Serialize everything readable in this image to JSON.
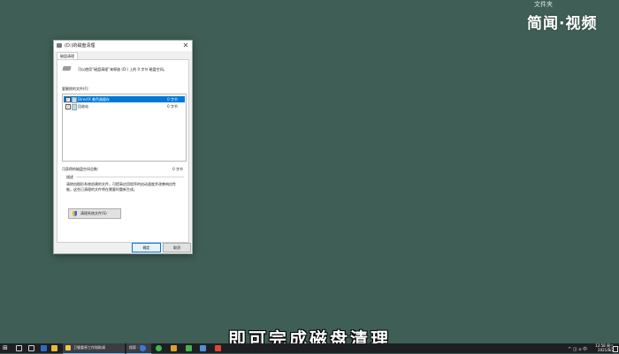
{
  "desktop": {
    "top_folder_label": "文件夹",
    "watermark": "简闻·视频",
    "subtitle": "即可完成磁盘清理"
  },
  "dialog": {
    "title": "(D:)的磁盘清理",
    "close_glyph": "✕",
    "tab_label": "磁盘清理",
    "intro": "可以使用“磁盘清理”来释放 (D:) 上的 0 字节 磁盘空间。",
    "files_label": "要删除的文件(F):",
    "files": [
      {
        "name": "DirectX 着色器缓存",
        "size": "0 字节",
        "checked": true,
        "selected": true
      },
      {
        "name": "回收站",
        "size": "0 字节",
        "checked": true,
        "selected": false
      }
    ],
    "total_label": "可获得的磁盘空间总数:",
    "total_value": "0 字节",
    "description_label": "描述",
    "description_text": "清除由图形系统创建的文件，可提高应用程序的启动速度并改善响应性能。这些已清理的文件将在需要时重新生成。",
    "cleanup_system_button": "清理系统文件(S)",
    "ok_button": "确定",
    "cancel_button": "取消"
  },
  "taskbar": {
    "start_glyph": "⊞",
    "explorer_task": "卫健委原工作指助请",
    "search_task": "搜索 - 1",
    "tray_text": "^ ◫ ⌂ 中",
    "clock_time": "12:58 周三",
    "clock_date": "2021/8/2"
  },
  "colors": {
    "desktop_bg": "#3f5e55",
    "taskbar_bg": "#1d1f23",
    "selection": "#0078d7"
  }
}
